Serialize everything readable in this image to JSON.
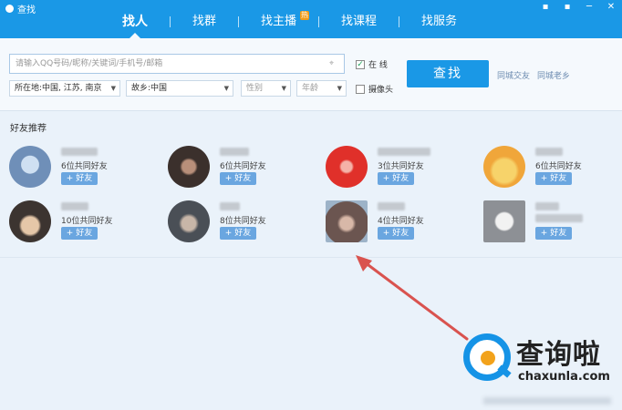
{
  "window": {
    "title": "查找",
    "controls": [
      "▪",
      "▪",
      "─",
      "✕"
    ]
  },
  "nav": {
    "tabs": [
      {
        "label": "找人",
        "active": true
      },
      {
        "label": "找群"
      },
      {
        "label": "找主播",
        "badge": "热"
      },
      {
        "label": "找课程"
      },
      {
        "label": "找服务"
      }
    ]
  },
  "search": {
    "placeholder": "请输入QQ号码/昵称/关键词/手机号/邮箱",
    "location_icon": "location-pin-icon",
    "online_label": "在  线",
    "online_checked": true,
    "camera_label": "摄像头",
    "camera_checked": false,
    "find_label": "查找",
    "links": [
      "同城交友",
      "同城老乡"
    ],
    "filters": {
      "location": "所在地:中国, 江苏, 南京",
      "hometown": "故乡:中国",
      "gender": "性别",
      "age": "年龄"
    }
  },
  "recommend": {
    "title": "好友推荐",
    "add_label": "+ 好友",
    "items": [
      {
        "mutual": "6位共同好友",
        "avatar_color": "#6f8fb8"
      },
      {
        "mutual": "6位共同好友",
        "avatar_color": "#4a3f3c"
      },
      {
        "mutual": "3位共同好友",
        "avatar_color": "#e0302a"
      },
      {
        "mutual": "6位共同好友",
        "avatar_color": "#f0a63a"
      },
      {
        "mutual": "10位共同好友",
        "avatar_color": "#6b5a4c"
      },
      {
        "mutual": "8位共同好友",
        "avatar_color": "#595e66"
      },
      {
        "mutual": "4位共同好友",
        "avatar_color": "#7d6a63"
      },
      {
        "mutual": "",
        "avatar_color": "#b5b8bc"
      }
    ]
  },
  "watermark": {
    "cn": "查询啦",
    "en": "chaxunla.com"
  },
  "colors": {
    "brand": "#1a98e6",
    "add_button": "#6aa6e0",
    "arrow": "#d9534f"
  }
}
